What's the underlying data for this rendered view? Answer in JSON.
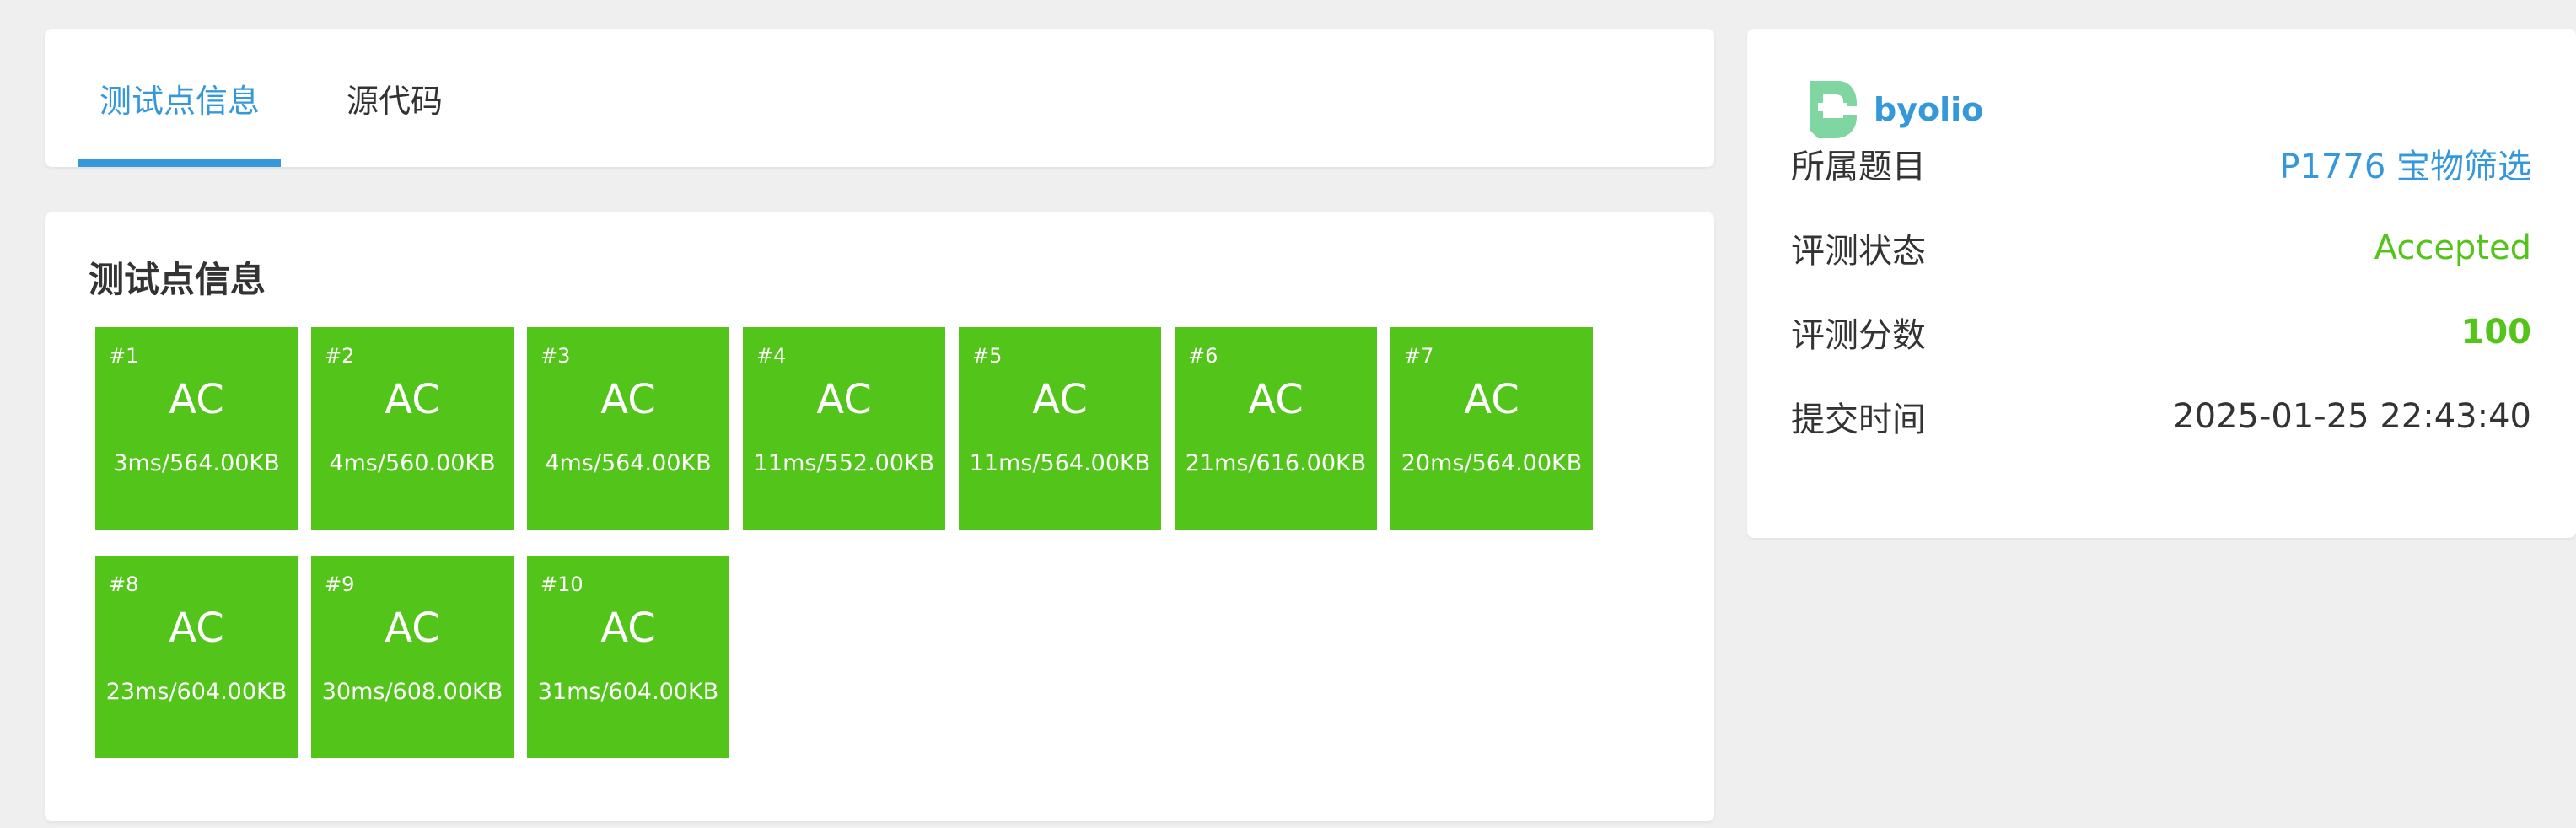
{
  "tabs": [
    {
      "label": "测试点信息",
      "active": true
    },
    {
      "label": "源代码",
      "active": false
    }
  ],
  "testcases": {
    "title": "测试点信息",
    "items": [
      {
        "id": "#1",
        "status": "AC",
        "stats": "3ms/564.00KB"
      },
      {
        "id": "#2",
        "status": "AC",
        "stats": "4ms/560.00KB"
      },
      {
        "id": "#3",
        "status": "AC",
        "stats": "4ms/564.00KB"
      },
      {
        "id": "#4",
        "status": "AC",
        "stats": "11ms/552.00KB"
      },
      {
        "id": "#5",
        "status": "AC",
        "stats": "11ms/564.00KB"
      },
      {
        "id": "#6",
        "status": "AC",
        "stats": "21ms/616.00KB"
      },
      {
        "id": "#7",
        "status": "AC",
        "stats": "20ms/564.00KB"
      },
      {
        "id": "#8",
        "status": "AC",
        "stats": "23ms/604.00KB"
      },
      {
        "id": "#9",
        "status": "AC",
        "stats": "30ms/608.00KB"
      },
      {
        "id": "#10",
        "status": "AC",
        "stats": "31ms/604.00KB"
      }
    ]
  },
  "info": {
    "user": {
      "name": "byolio",
      "avatar_icon": "user-logo-icon"
    },
    "problem_label": "所属题目",
    "problem_value": "P1776 宝物筛选",
    "status_label": "评测状态",
    "status_value": "Accepted",
    "score_label": "评测分数",
    "score_value": "100",
    "time_label": "提交时间",
    "time_value": "2025-01-25 22:43:40"
  },
  "colors": {
    "accent": "#3498db",
    "accepted": "#52c41a",
    "background": "#efefef",
    "logo": "#7fd6a0"
  }
}
